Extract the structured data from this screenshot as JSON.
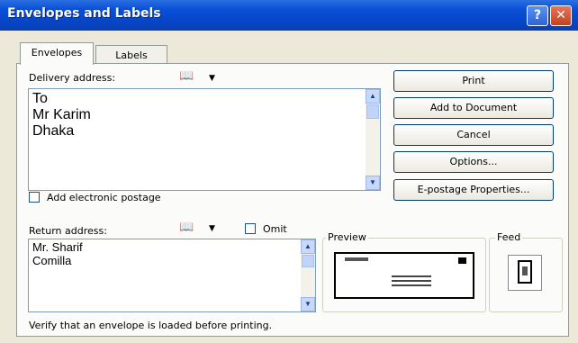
{
  "window": {
    "title": "Envelopes and Labels",
    "help_symbol": "?",
    "close_symbol": "✕"
  },
  "tabs": {
    "envelopes": "Envelopes",
    "labels": "Labels"
  },
  "delivery": {
    "label": "Delivery address:",
    "address_lines": [
      "To",
      "Mr Karim",
      "Dhaka"
    ]
  },
  "electronic_postage": {
    "label": "Add electronic postage",
    "checked": false
  },
  "return": {
    "label": "Return address:",
    "omit_label": "Omit",
    "omit_checked": false,
    "address_lines": [
      "Mr. Sharif",
      "Comilla"
    ]
  },
  "buttons": {
    "print": "Print",
    "add_to_document": "Add to Document",
    "cancel": "Cancel",
    "options": "Options...",
    "epostage_properties": "E-postage Properties..."
  },
  "preview": {
    "label": "Preview"
  },
  "feed": {
    "label": "Feed"
  },
  "status": {
    "message": "Verify that an envelope is loaded before printing."
  },
  "icons": {
    "address_book": "address-book-icon",
    "dropdown": "dropdown-arrow-icon"
  }
}
